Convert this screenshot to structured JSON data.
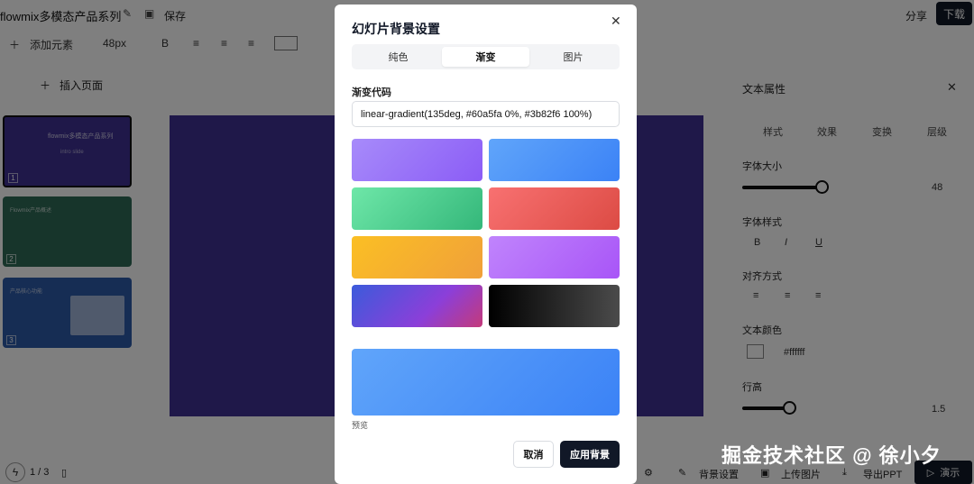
{
  "topbar": {
    "doc_title": "flowmix多模态产品系列",
    "edit_icon": "edit-icon",
    "save_icon": "save-icon",
    "save_label": "保存",
    "share_label": "分享",
    "download_label": "下载"
  },
  "toolbar": {
    "add_label": "添加元素",
    "font_size": "48px",
    "bold": "B",
    "align_icons": [
      "align-left-icon",
      "align-center-icon",
      "align-right-icon"
    ]
  },
  "sidebar": {
    "insert_label": "插入页面",
    "thumbs": [
      {
        "num": "1",
        "title": "flowmix多模态产品系列",
        "subtitle": "intro slide",
        "color": "#3e3193"
      },
      {
        "num": "2",
        "title": "Flowmix产品概述",
        "color": "#2f6b57"
      },
      {
        "num": "3",
        "title": "产品核心功能",
        "color": "#2d5aa8"
      }
    ]
  },
  "right_panel": {
    "title": "文本属性",
    "tabs": [
      "样式",
      "效果",
      "变换",
      "层级"
    ],
    "font_size_label": "字体大小",
    "font_size_value": "48",
    "font_style_label": "字体样式",
    "font_style_buttons": [
      "B",
      "I",
      "U"
    ],
    "align_label": "对齐方式",
    "text_color_label": "文本颜色",
    "text_color_value": "#ffffff",
    "line_height_label": "行高",
    "line_height_value": "1.5"
  },
  "bottombar": {
    "page_indicator": "1 / 3",
    "bg_settings_label": "背景设置",
    "upload_label": "上传图片",
    "export_label": "导出PPT",
    "present_label": "演示"
  },
  "watermark": "掘金技术社区 @ 徐小夕",
  "modal": {
    "title": "幻灯片背景设置",
    "tabs": [
      {
        "label": "纯色",
        "active": false
      },
      {
        "label": "渐变",
        "active": true
      },
      {
        "label": "图片",
        "active": false
      }
    ],
    "code_label": "渐变代码",
    "code_value": "linear-gradient(135deg, #60a5fa 0%, #3b82f6 100%)",
    "presets": [
      "linear-gradient(135deg, #a78bfa 0%, #8b5cf6 100%)",
      "linear-gradient(135deg, #60a5fa 0%, #3b82f6 100%)",
      "linear-gradient(135deg, #6ee7a8 0%, #34b77a 100%)",
      "linear-gradient(135deg, #f87171 0%, #dc4b44 100%)",
      "linear-gradient(135deg, #fbbf24 0%, #f0a03a 100%)",
      "linear-gradient(135deg, #c084fc 0%, #a855f7 100%)",
      "linear-gradient(135deg, #3b5bdb 0%, #8b3fd9 60%, #c43a7a 100%)",
      "linear-gradient(90deg, #000000 0%, #4b4b4b 100%)"
    ],
    "preview_label": "预览",
    "cancel_label": "取消",
    "apply_label": "应用背景"
  }
}
